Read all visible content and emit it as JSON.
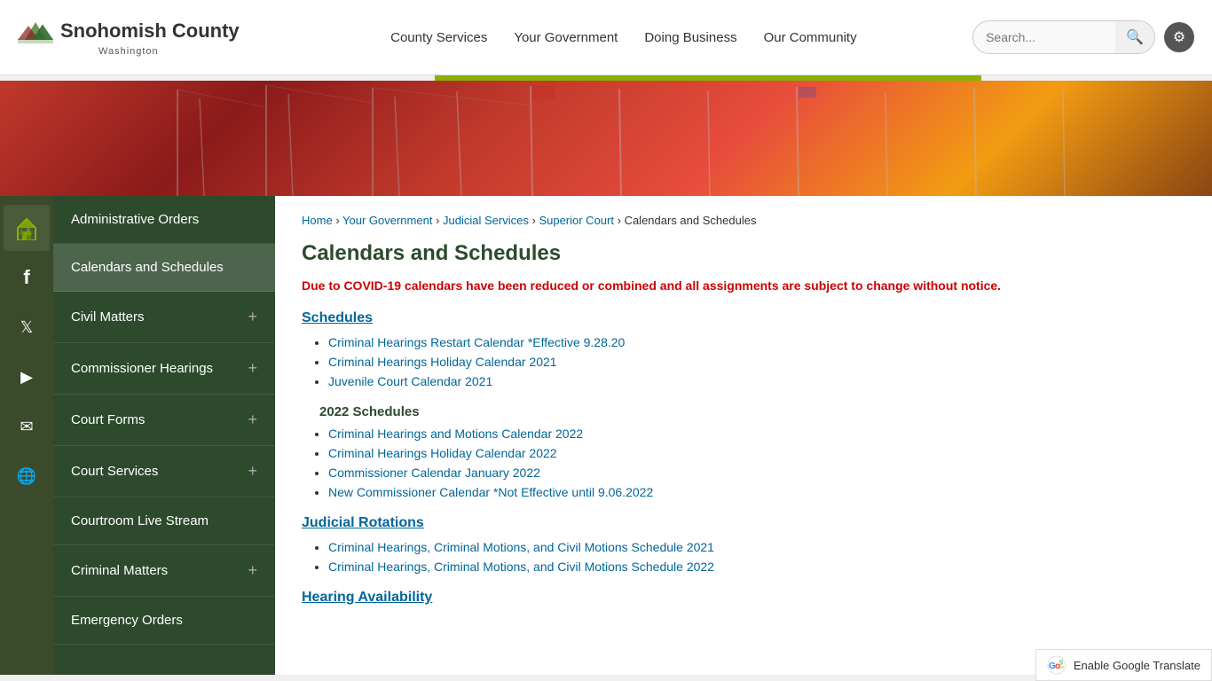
{
  "header": {
    "logo": {
      "name": "Snohomish County",
      "sub": "Washington"
    },
    "nav": [
      {
        "label": "County Services",
        "href": "#"
      },
      {
        "label": "Your Government",
        "href": "#"
      },
      {
        "label": "Doing Business",
        "href": "#"
      },
      {
        "label": "Our Community",
        "href": "#"
      }
    ],
    "search": {
      "placeholder": "Search...",
      "label": "Search ."
    },
    "settings_label": "⚙"
  },
  "social": [
    {
      "icon": "🏔",
      "name": "home-icon"
    },
    {
      "icon": "f",
      "name": "facebook-icon"
    },
    {
      "icon": "🐦",
      "name": "twitter-icon"
    },
    {
      "icon": "▶",
      "name": "youtube-icon"
    },
    {
      "icon": "✉",
      "name": "email-icon"
    },
    {
      "icon": "🌐",
      "name": "globe-icon"
    }
  ],
  "sidebar": {
    "items": [
      {
        "label": "Administrative Orders",
        "has_plus": false
      },
      {
        "label": "Calendars and Schedules",
        "has_plus": false,
        "active": true
      },
      {
        "label": "Civil Matters",
        "has_plus": true
      },
      {
        "label": "Commissioner Hearings",
        "has_plus": true
      },
      {
        "label": "Court Forms",
        "has_plus": true
      },
      {
        "label": "Court Services",
        "has_plus": true
      },
      {
        "label": "Courtroom Live Stream",
        "has_plus": false
      },
      {
        "label": "Criminal Matters",
        "has_plus": true
      },
      {
        "label": "Emergency Orders",
        "has_plus": false
      }
    ]
  },
  "breadcrumb": {
    "items": [
      {
        "label": "Home",
        "href": "#"
      },
      {
        "label": "Your Government",
        "href": "#"
      },
      {
        "label": "Judicial Services",
        "href": "#"
      },
      {
        "label": "Superior Court",
        "href": "#"
      }
    ],
    "current": "Calendars and Schedules"
  },
  "page": {
    "title": "Calendars and Schedules",
    "covid_notice": "Due to COVID-19 calendars have been reduced or combined and all assignments are subject to change without notice.",
    "sections": [
      {
        "heading": "Schedules",
        "links": [
          {
            "label": "Criminal Hearings Restart Calendar *Effective 9.28.20",
            "href": "#"
          },
          {
            "label": "Criminal Hearings Holiday Calendar 2021",
            "href": "#"
          },
          {
            "label": "Juvenile Court Calendar 2021",
            "href": "#"
          }
        ]
      },
      {
        "sub_heading": "2022 Schedules",
        "links": [
          {
            "label": "Criminal Hearings and Motions Calendar 2022",
            "href": "#"
          },
          {
            "label": "Criminal Hearings Holiday Calendar 2022",
            "href": "#"
          },
          {
            "label": "Commissioner Calendar January 2022",
            "href": "#"
          },
          {
            "label": "New Commissioner Calendar *Not Effective until 9.06.2022",
            "href": "#"
          }
        ]
      },
      {
        "heading": "Judicial Rotations",
        "links": [
          {
            "label": "Criminal Hearings, Criminal Motions, and Civil Motions Schedule 2021",
            "href": "#"
          },
          {
            "label": "Criminal Hearings, Criminal Motions, and Civil Motions Schedule 2022",
            "href": "#"
          }
        ]
      },
      {
        "heading": "Hearing Availability",
        "links": []
      }
    ]
  },
  "footer": {
    "translate_label": "Enable Google Translate"
  }
}
